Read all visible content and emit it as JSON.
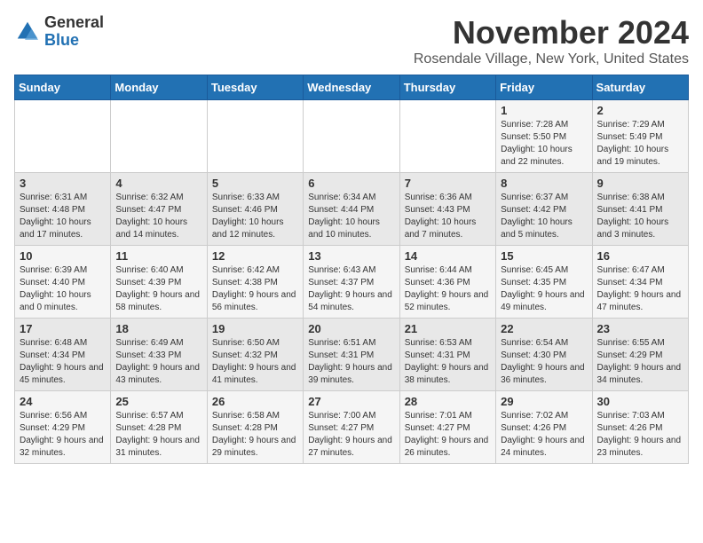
{
  "logo": {
    "general": "General",
    "blue": "Blue"
  },
  "title": "November 2024",
  "location": "Rosendale Village, New York, United States",
  "days_of_week": [
    "Sunday",
    "Monday",
    "Tuesday",
    "Wednesday",
    "Thursday",
    "Friday",
    "Saturday"
  ],
  "weeks": [
    [
      {
        "day": "",
        "info": ""
      },
      {
        "day": "",
        "info": ""
      },
      {
        "day": "",
        "info": ""
      },
      {
        "day": "",
        "info": ""
      },
      {
        "day": "",
        "info": ""
      },
      {
        "day": "1",
        "info": "Sunrise: 7:28 AM\nSunset: 5:50 PM\nDaylight: 10 hours and 22 minutes."
      },
      {
        "day": "2",
        "info": "Sunrise: 7:29 AM\nSunset: 5:49 PM\nDaylight: 10 hours and 19 minutes."
      }
    ],
    [
      {
        "day": "3",
        "info": "Sunrise: 6:31 AM\nSunset: 4:48 PM\nDaylight: 10 hours and 17 minutes."
      },
      {
        "day": "4",
        "info": "Sunrise: 6:32 AM\nSunset: 4:47 PM\nDaylight: 10 hours and 14 minutes."
      },
      {
        "day": "5",
        "info": "Sunrise: 6:33 AM\nSunset: 4:46 PM\nDaylight: 10 hours and 12 minutes."
      },
      {
        "day": "6",
        "info": "Sunrise: 6:34 AM\nSunset: 4:44 PM\nDaylight: 10 hours and 10 minutes."
      },
      {
        "day": "7",
        "info": "Sunrise: 6:36 AM\nSunset: 4:43 PM\nDaylight: 10 hours and 7 minutes."
      },
      {
        "day": "8",
        "info": "Sunrise: 6:37 AM\nSunset: 4:42 PM\nDaylight: 10 hours and 5 minutes."
      },
      {
        "day": "9",
        "info": "Sunrise: 6:38 AM\nSunset: 4:41 PM\nDaylight: 10 hours and 3 minutes."
      }
    ],
    [
      {
        "day": "10",
        "info": "Sunrise: 6:39 AM\nSunset: 4:40 PM\nDaylight: 10 hours and 0 minutes."
      },
      {
        "day": "11",
        "info": "Sunrise: 6:40 AM\nSunset: 4:39 PM\nDaylight: 9 hours and 58 minutes."
      },
      {
        "day": "12",
        "info": "Sunrise: 6:42 AM\nSunset: 4:38 PM\nDaylight: 9 hours and 56 minutes."
      },
      {
        "day": "13",
        "info": "Sunrise: 6:43 AM\nSunset: 4:37 PM\nDaylight: 9 hours and 54 minutes."
      },
      {
        "day": "14",
        "info": "Sunrise: 6:44 AM\nSunset: 4:36 PM\nDaylight: 9 hours and 52 minutes."
      },
      {
        "day": "15",
        "info": "Sunrise: 6:45 AM\nSunset: 4:35 PM\nDaylight: 9 hours and 49 minutes."
      },
      {
        "day": "16",
        "info": "Sunrise: 6:47 AM\nSunset: 4:34 PM\nDaylight: 9 hours and 47 minutes."
      }
    ],
    [
      {
        "day": "17",
        "info": "Sunrise: 6:48 AM\nSunset: 4:34 PM\nDaylight: 9 hours and 45 minutes."
      },
      {
        "day": "18",
        "info": "Sunrise: 6:49 AM\nSunset: 4:33 PM\nDaylight: 9 hours and 43 minutes."
      },
      {
        "day": "19",
        "info": "Sunrise: 6:50 AM\nSunset: 4:32 PM\nDaylight: 9 hours and 41 minutes."
      },
      {
        "day": "20",
        "info": "Sunrise: 6:51 AM\nSunset: 4:31 PM\nDaylight: 9 hours and 39 minutes."
      },
      {
        "day": "21",
        "info": "Sunrise: 6:53 AM\nSunset: 4:31 PM\nDaylight: 9 hours and 38 minutes."
      },
      {
        "day": "22",
        "info": "Sunrise: 6:54 AM\nSunset: 4:30 PM\nDaylight: 9 hours and 36 minutes."
      },
      {
        "day": "23",
        "info": "Sunrise: 6:55 AM\nSunset: 4:29 PM\nDaylight: 9 hours and 34 minutes."
      }
    ],
    [
      {
        "day": "24",
        "info": "Sunrise: 6:56 AM\nSunset: 4:29 PM\nDaylight: 9 hours and 32 minutes."
      },
      {
        "day": "25",
        "info": "Sunrise: 6:57 AM\nSunset: 4:28 PM\nDaylight: 9 hours and 31 minutes."
      },
      {
        "day": "26",
        "info": "Sunrise: 6:58 AM\nSunset: 4:28 PM\nDaylight: 9 hours and 29 minutes."
      },
      {
        "day": "27",
        "info": "Sunrise: 7:00 AM\nSunset: 4:27 PM\nDaylight: 9 hours and 27 minutes."
      },
      {
        "day": "28",
        "info": "Sunrise: 7:01 AM\nSunset: 4:27 PM\nDaylight: 9 hours and 26 minutes."
      },
      {
        "day": "29",
        "info": "Sunrise: 7:02 AM\nSunset: 4:26 PM\nDaylight: 9 hours and 24 minutes."
      },
      {
        "day": "30",
        "info": "Sunrise: 7:03 AM\nSunset: 4:26 PM\nDaylight: 9 hours and 23 minutes."
      }
    ]
  ]
}
